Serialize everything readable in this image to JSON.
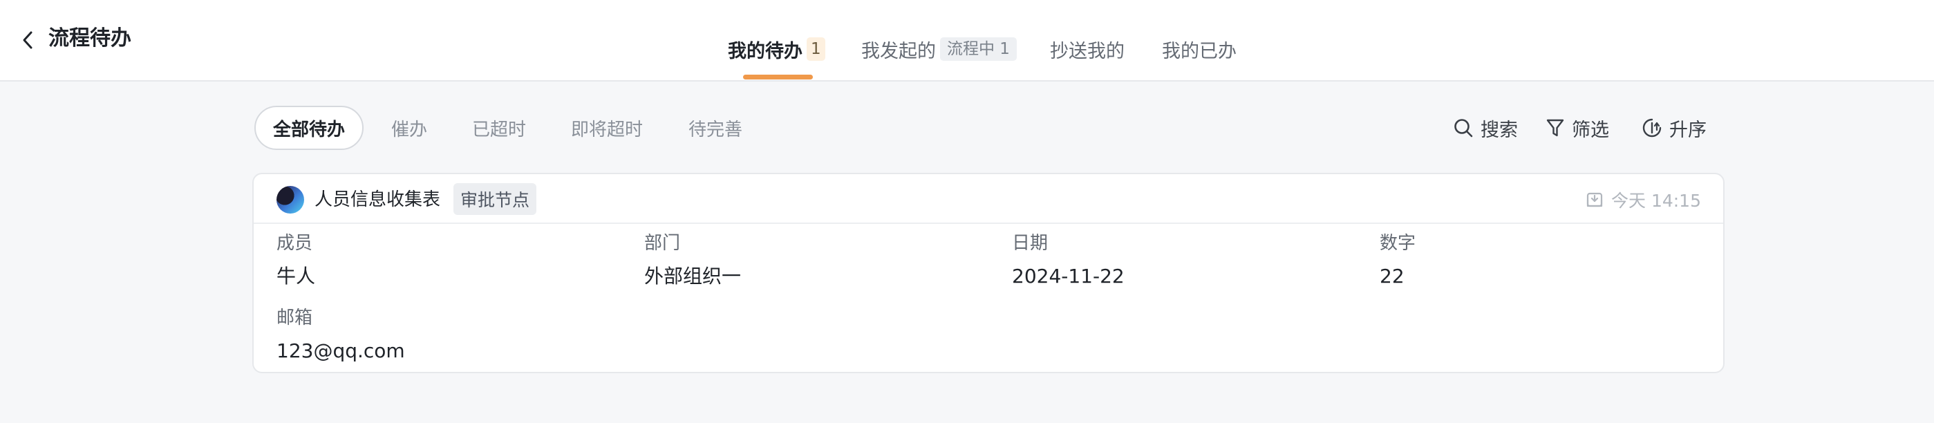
{
  "header": {
    "title": "流程待办",
    "tabs": [
      {
        "label": "我的待办",
        "badge": "1"
      },
      {
        "label": "我发起的",
        "badge": "流程中 1"
      },
      {
        "label": "抄送我的"
      },
      {
        "label": "我的已办"
      }
    ],
    "active_tab": "我的待办"
  },
  "filters": {
    "chips": [
      "全部待办",
      "催办",
      "已超时",
      "即将超时",
      "待完善"
    ],
    "active": "全部待办"
  },
  "toolbar": {
    "search": "搜索",
    "filter": "筛选",
    "sort": "升序"
  },
  "card": {
    "form_name": "人员信息收集表",
    "node": "审批节点",
    "time": "今天 14:15",
    "fields": [
      {
        "label": "成员",
        "value": "牛人"
      },
      {
        "label": "部门",
        "value": "外部组织一"
      },
      {
        "label": "日期",
        "value": "2024-11-22"
      },
      {
        "label": "数字",
        "value": "22"
      },
      {
        "label": "邮箱",
        "value": "123@qq.com"
      }
    ]
  },
  "colors": {
    "accent": "#f0994a",
    "badge_bg": "#fdf0df",
    "page_bg": "#f6f7f9"
  },
  "icons": {
    "back": "chevron-left-icon",
    "search": "search-icon",
    "filter": "funnel-icon",
    "sort": "sort-icon",
    "time": "download-tray-icon"
  }
}
